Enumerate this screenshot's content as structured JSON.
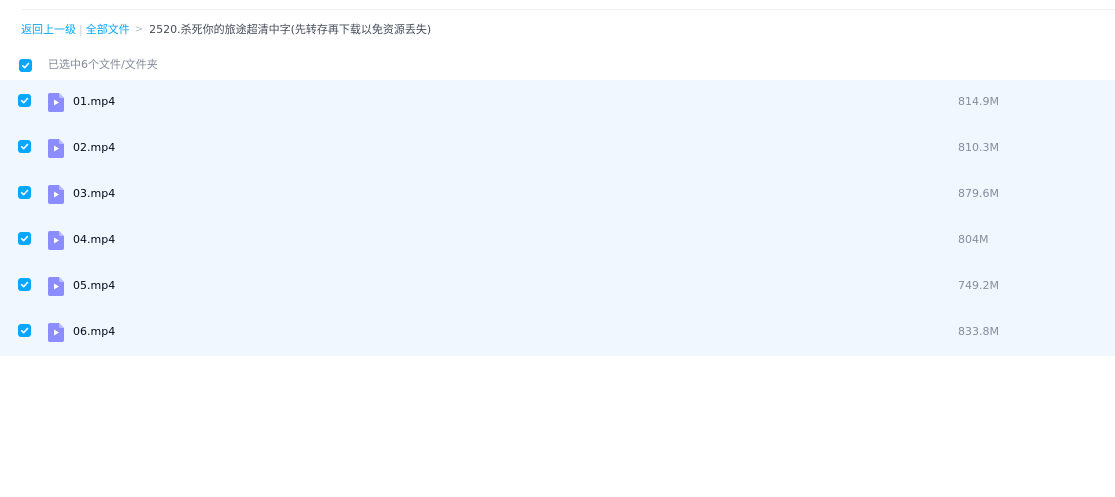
{
  "breadcrumb": {
    "back_label": "返回上一级",
    "root_label": "全部文件",
    "separator": ">",
    "current_folder": "2520.杀死你的旅途超清中字(先转存再下载以免资源丢失)"
  },
  "selection": {
    "summary": "已选中6个文件/文件夹",
    "all_checked": true
  },
  "files": [
    {
      "name": "01.mp4",
      "size": "814.9M",
      "type": "video-file-icon",
      "checked": true
    },
    {
      "name": "02.mp4",
      "size": "810.3M",
      "type": "video-file-icon",
      "checked": true
    },
    {
      "name": "03.mp4",
      "size": "879.6M",
      "type": "video-file-icon",
      "checked": true
    },
    {
      "name": "04.mp4",
      "size": "804M",
      "type": "video-file-icon",
      "checked": true
    },
    {
      "name": "05.mp4",
      "size": "749.2M",
      "type": "video-file-icon",
      "checked": true
    },
    {
      "name": "06.mp4",
      "size": "833.8M",
      "type": "video-file-icon",
      "checked": true
    }
  ],
  "colors": {
    "accent": "#06a7ff",
    "row_background": "#f1f7ff",
    "file_icon": "#8b8cff"
  }
}
